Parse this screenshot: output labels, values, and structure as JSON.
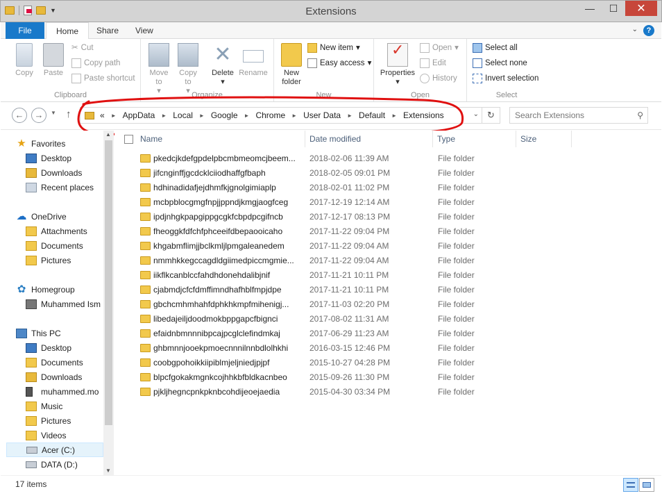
{
  "window": {
    "title": "Extensions"
  },
  "ribbon_tabs": [
    "File",
    "Home",
    "Share",
    "View"
  ],
  "ribbon": {
    "clipboard": {
      "label": "Clipboard",
      "copy": "Copy",
      "paste": "Paste",
      "cut": "Cut",
      "copy_path": "Copy path",
      "paste_shortcut": "Paste shortcut"
    },
    "organize": {
      "label": "Organize",
      "move_to": "Move to",
      "copy_to": "Copy to",
      "delete": "Delete",
      "rename": "Rename"
    },
    "new": {
      "label": "New",
      "new_folder": "New folder",
      "new_item": "New item",
      "easy_access": "Easy access"
    },
    "open": {
      "label": "Open",
      "properties": "Properties",
      "open": "Open",
      "edit": "Edit",
      "history": "History"
    },
    "select": {
      "label": "Select",
      "select_all": "Select all",
      "select_none": "Select none",
      "invert": "Invert selection"
    }
  },
  "address": {
    "prefix": "«",
    "crumbs": [
      "AppData",
      "Local",
      "Google",
      "Chrome",
      "User Data",
      "Default",
      "Extensions"
    ]
  },
  "search": {
    "placeholder": "Search Extensions"
  },
  "columns": [
    "Name",
    "Date modified",
    "Type",
    "Size"
  ],
  "nav": [
    {
      "label": "Favorites",
      "icon": "star-icon"
    },
    {
      "label": "Desktop",
      "icon": "desktop-icon"
    },
    {
      "label": "Downloads",
      "icon": "downloads-icon"
    },
    {
      "label": "Recent places",
      "icon": "recent-places-icon"
    },
    {
      "label": "OneDrive",
      "icon": "onedrive-icon"
    },
    {
      "label": "Attachments",
      "icon": "folder-icon"
    },
    {
      "label": "Documents",
      "icon": "folder-icon"
    },
    {
      "label": "Pictures",
      "icon": "folder-icon"
    },
    {
      "label": "Homegroup",
      "icon": "homegroup-icon"
    },
    {
      "label": "Muhammed Ism",
      "icon": "user-icon"
    },
    {
      "label": "This PC",
      "icon": "computer-icon"
    },
    {
      "label": "Desktop",
      "icon": "desktop-icon"
    },
    {
      "label": "Documents",
      "icon": "folder-icon"
    },
    {
      "label": "Downloads",
      "icon": "downloads-icon"
    },
    {
      "label": "muhammed.mo",
      "icon": "phone-icon"
    },
    {
      "label": "Music",
      "icon": "music-folder-icon"
    },
    {
      "label": "Pictures",
      "icon": "folder-icon"
    },
    {
      "label": "Videos",
      "icon": "folder-icon"
    },
    {
      "label": "Acer (C:)",
      "icon": "drive-icon"
    },
    {
      "label": "DATA (D:)",
      "icon": "drive-icon"
    }
  ],
  "files": [
    {
      "name": "pkedcjkdefgpdelpbcmbmeomcjbeem...",
      "date": "2018-02-06 11:39 AM",
      "type": "File folder"
    },
    {
      "name": "jifcnginffjgcdcklciiodhaffgfbaph",
      "date": "2018-02-05 09:01 PM",
      "type": "File folder"
    },
    {
      "name": "hdhinadidafjejdhmfkjgnolgimiaplp",
      "date": "2018-02-01 11:02 PM",
      "type": "File folder"
    },
    {
      "name": "mcbpblocgmgfnpjjppndjkmgjaogfceg",
      "date": "2017-12-19 12:14 AM",
      "type": "File folder"
    },
    {
      "name": "ipdjnhgkpapgippgcgkfcbpdpcgifncb",
      "date": "2017-12-17 08:13 PM",
      "type": "File folder"
    },
    {
      "name": "fheoggkfdfchfphceeifdbepaooicaho",
      "date": "2017-11-22 09:04 PM",
      "type": "File folder"
    },
    {
      "name": "khgabmflimjjbclkmljlpmgaleanedem",
      "date": "2017-11-22 09:04 AM",
      "type": "File folder"
    },
    {
      "name": "nmmhkkegccagdldgiimedpiccmgmie...",
      "date": "2017-11-22 09:04 AM",
      "type": "File folder"
    },
    {
      "name": "iikflkcanblccfahdhdonehdalibjnif",
      "date": "2017-11-21 10:11 PM",
      "type": "File folder"
    },
    {
      "name": "cjabmdjcfcfdmffimndhafhblfmpjdpe",
      "date": "2017-11-21 10:11 PM",
      "type": "File folder"
    },
    {
      "name": "gbchcmhmhahfdphkhkmpfmihenigj...",
      "date": "2017-11-03 02:20 PM",
      "type": "File folder"
    },
    {
      "name": "libedajeiljdoodmokbppgapcfbignci",
      "date": "2017-08-02 11:31 AM",
      "type": "File folder"
    },
    {
      "name": "efaidnbmnnnibpcajpcglclefindmkaj",
      "date": "2017-06-29 11:23 AM",
      "type": "File folder"
    },
    {
      "name": "ghbmnnjooekpmoecnnnilnnbdlolhkhi",
      "date": "2016-03-15 12:46 PM",
      "type": "File folder"
    },
    {
      "name": "coobgpohoikkiipiblmjeljniedjpjpf",
      "date": "2015-10-27 04:28 PM",
      "type": "File folder"
    },
    {
      "name": "blpcfgokakmgnkcojhhkbfbldkacnbeo",
      "date": "2015-09-26 11:30 PM",
      "type": "File folder"
    },
    {
      "name": "pjkljhegncpnkpknbcohdijeoejaedia",
      "date": "2015-04-30 03:34 PM",
      "type": "File folder"
    }
  ],
  "status": {
    "count": "17 items"
  },
  "colors": {
    "file_tab": "#1979ca",
    "close_button": "#c7463a",
    "folder": "#f2c94c",
    "annotation": "#e01010"
  }
}
